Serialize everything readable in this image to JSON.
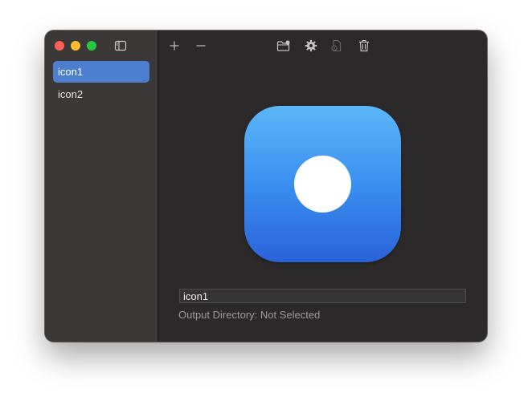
{
  "window": {
    "traffic_lights": [
      "close",
      "minimize",
      "zoom"
    ]
  },
  "sidebar": {
    "toggle_icon": "sidebar-icon",
    "items": [
      {
        "label": "icon1",
        "selected": true
      },
      {
        "label": "icon2",
        "selected": false
      }
    ]
  },
  "toolbar": {
    "buttons": [
      {
        "icon": "plus-icon",
        "enabled": true
      },
      {
        "icon": "minus-icon",
        "enabled": true
      },
      {
        "icon": "folder-badge-icon",
        "enabled": true
      },
      {
        "icon": "gear-icon",
        "enabled": true
      },
      {
        "icon": "export-document-icon",
        "enabled": false
      },
      {
        "icon": "trash-icon",
        "enabled": true
      }
    ]
  },
  "preview": {
    "gradient_top": "#5bb7f7",
    "gradient_bottom": "#2a63d8",
    "dot_color": "#ffffff"
  },
  "detail": {
    "name_value": "icon1",
    "output_directory": "Output Directory: Not Selected"
  },
  "colors": {
    "accent": "#4d7fd1",
    "window_bg": "#2b2929",
    "sidebar_bg": "#3a3938"
  }
}
